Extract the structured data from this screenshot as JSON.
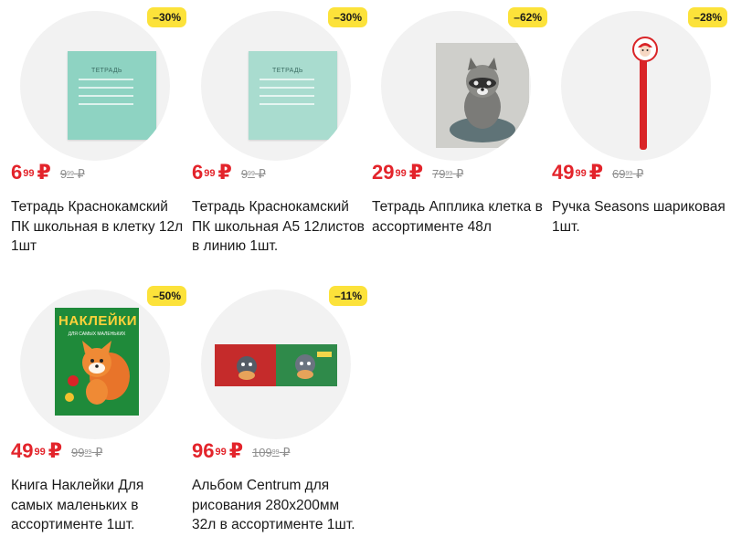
{
  "products": [
    {
      "discount": "–30%",
      "price_main": "6",
      "price_kop": "99",
      "currency": "₽",
      "old_main": "9",
      "old_kop": "99",
      "title": "Тетрадь Краснокамский ПК школьная в клетку 12л 1шт",
      "image": "notebook-teal",
      "image_text": "ТЕТРАДЬ"
    },
    {
      "discount": "–30%",
      "price_main": "6",
      "price_kop": "99",
      "currency": "₽",
      "old_main": "9",
      "old_kop": "99",
      "title": "Тетрадь Краснокамский ПК школьная А5 12листов в линию 1шт.",
      "image": "notebook-light-teal",
      "image_text": "ТЕТРАДЬ"
    },
    {
      "discount": "–62%",
      "price_main": "29",
      "price_kop": "99",
      "currency": "₽",
      "old_main": "79",
      "old_kop": "99",
      "title": "Тетрадь Апплика клетка в ассортименте 48л",
      "image": "notebook-raccoon"
    },
    {
      "discount": "–28%",
      "price_main": "49",
      "price_kop": "99",
      "currency": "₽",
      "old_main": "69",
      "old_kop": "99",
      "title": "Ручка Seasons шариковая 1шт.",
      "image": "red-pen-santa"
    },
    {
      "discount": "–50%",
      "price_main": "49",
      "price_kop": "99",
      "currency": "₽",
      "old_main": "99",
      "old_kop": "99",
      "title": "Книга Наклейки Для самых маленьких в ассортименте 1шт.",
      "image": "sticker-book-fox",
      "image_text": "НАКЛЕЙКИ",
      "image_subtext": "ДЛЯ САМЫХ МАЛЕНЬКИХ"
    },
    {
      "discount": "–11%",
      "price_main": "96",
      "price_kop": "99",
      "currency": "₽",
      "old_main": "109",
      "old_kop": "99",
      "title": "Альбом Centrum для рисования 280x200мм 32л в ассортименте 1шт.",
      "image": "drawing-album"
    }
  ],
  "colors": {
    "price": "#e3242b",
    "badge": "#fce23a",
    "circle": "#f2f2f2",
    "old_price": "#8f8f8f"
  }
}
